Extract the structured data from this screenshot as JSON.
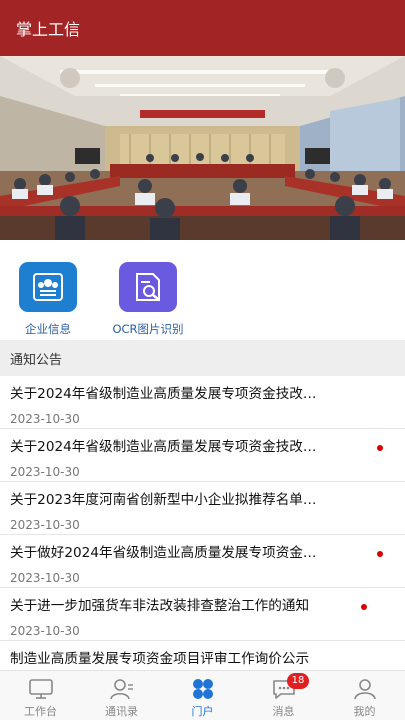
{
  "header": {
    "title": "掌上工信"
  },
  "apps": [
    {
      "label": "企业信息",
      "icon": "enterprise-info-icon",
      "color": "#1e7fd1"
    },
    {
      "label": "OCR图片识别",
      "icon": "ocr-scan-icon",
      "color": "#6a5ae0"
    }
  ],
  "notice": {
    "heading": "通知公告",
    "items": [
      {
        "title": "关于2024年省级制造业高质量发展专项资金技改…",
        "date": "2023-10-30",
        "unread": false
      },
      {
        "title": "关于2024年省级制造业高质量发展专项资金技改…",
        "date": "2023-10-30",
        "unread": true
      },
      {
        "title": "关于2023年度河南省创新型中小企业拟推荐名单…",
        "date": "2023-10-30",
        "unread": false
      },
      {
        "title": "关于做好2024年省级制造业高质量发展专项资金…",
        "date": "2023-10-30",
        "unread": true
      },
      {
        "title": "关于进一步加强货车非法改装排查整治工作的通知",
        "date": "2023-10-30",
        "unread": true
      },
      {
        "title": "制造业高质量发展专项资金项目评审工作询价公示",
        "date": "",
        "unread": false
      }
    ]
  },
  "tabbar": {
    "tabs": [
      {
        "label": "工作台",
        "icon": "workbench-icon",
        "active": false
      },
      {
        "label": "通讯录",
        "icon": "contacts-icon",
        "active": false
      },
      {
        "label": "门户",
        "icon": "portal-icon",
        "active": true
      },
      {
        "label": "消息",
        "icon": "message-icon",
        "active": false,
        "badge": "18"
      },
      {
        "label": "我的",
        "icon": "profile-icon",
        "active": false
      }
    ]
  },
  "colors": {
    "header": "#a32424",
    "active_tab": "#1f74d6",
    "badge": "#e02020"
  }
}
